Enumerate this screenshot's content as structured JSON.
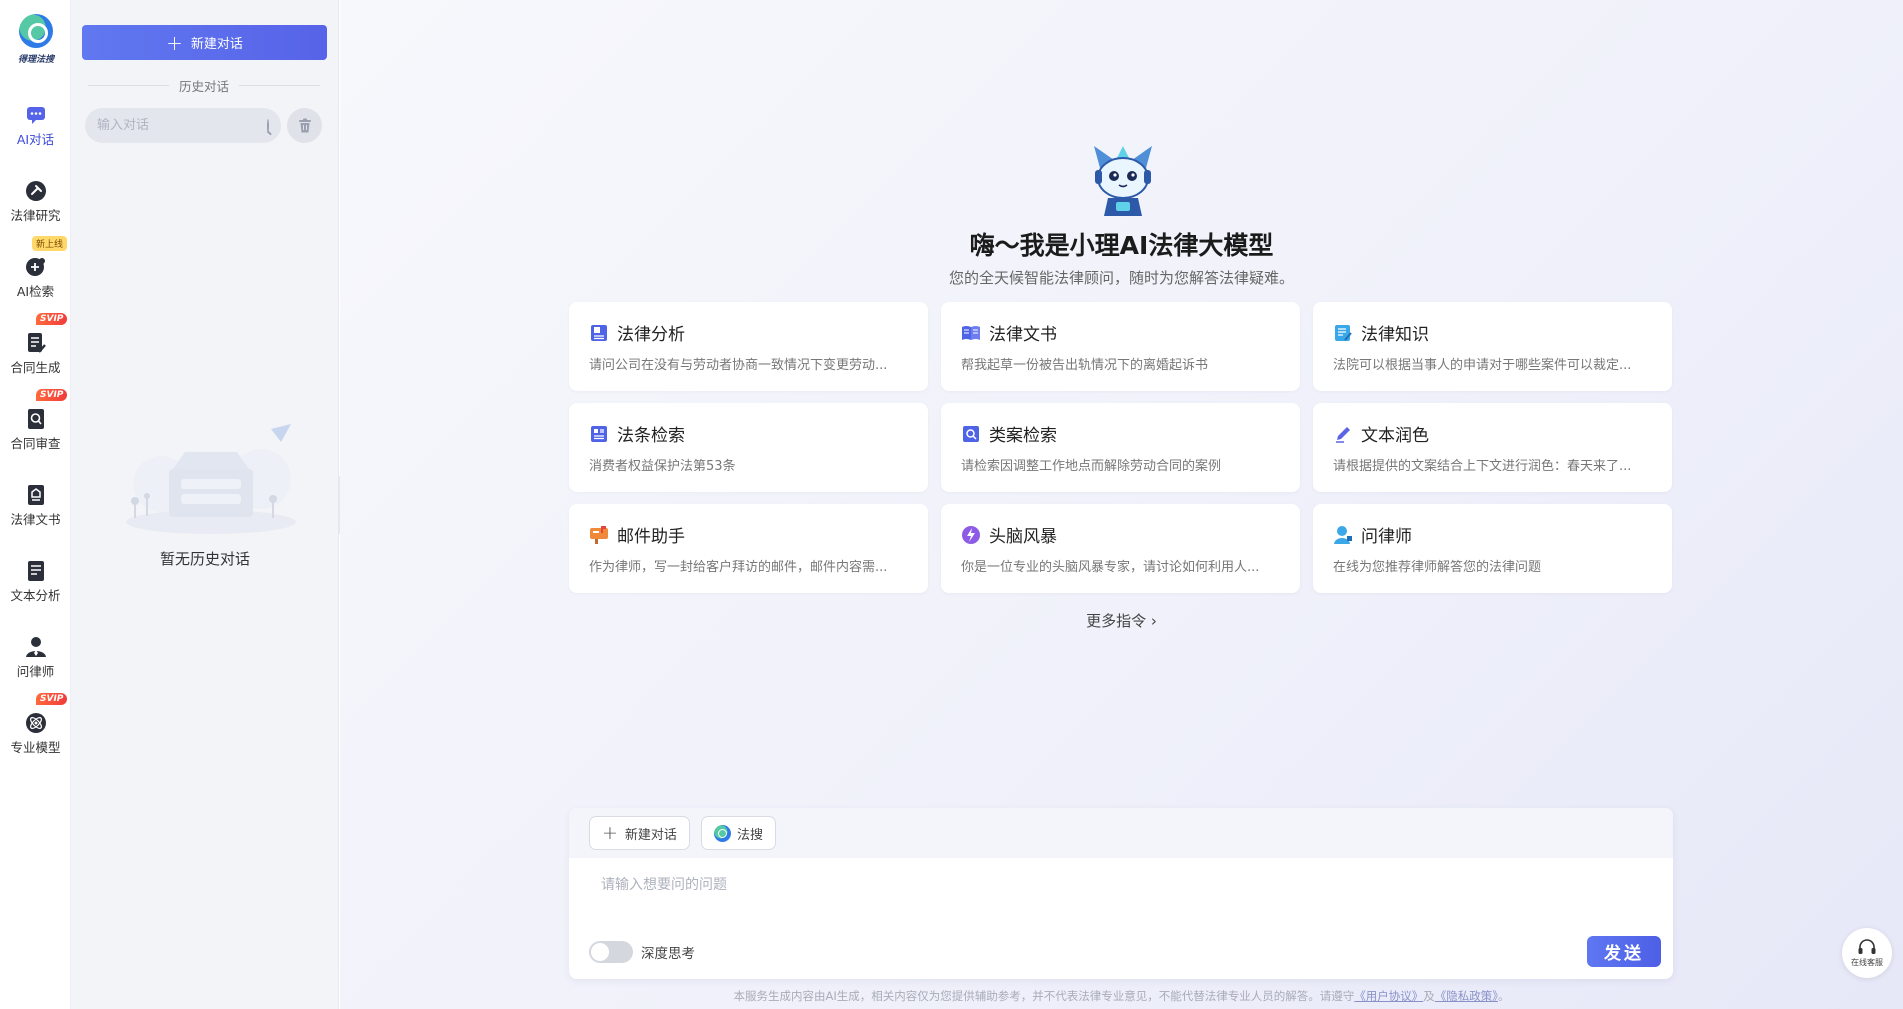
{
  "logo": {
    "text": "得理法搜"
  },
  "rail": {
    "items": [
      {
        "label": "AI对话",
        "icon": "chat-bubble-icon",
        "active": true
      },
      {
        "label": "法律研究",
        "icon": "magnifier-gavel-icon"
      },
      {
        "label": "AI检索",
        "icon": "ai-search-icon",
        "badge": "新上线"
      },
      {
        "label": "合同生成",
        "icon": "doc-pen-icon",
        "badge": "SVIP"
      },
      {
        "label": "合同审查",
        "icon": "doc-search-icon",
        "badge": "SVIP"
      },
      {
        "label": "法律文书",
        "icon": "doc-seal-icon"
      },
      {
        "label": "文本分析",
        "icon": "doc-lines-icon"
      },
      {
        "label": "问律师",
        "icon": "lawyer-icon"
      },
      {
        "label": "专业模型",
        "icon": "atom-icon",
        "badge": "SVIP"
      }
    ]
  },
  "history": {
    "new_chat_label": "新建对话",
    "section_title": "历史对话",
    "search_placeholder": "输入对话",
    "empty_text": "暂无历史对话"
  },
  "hero": {
    "title": "嗨～我是小理AI法律大模型",
    "subtitle": "您的全天候智能法律顾问，随时为您解答法律疑难。"
  },
  "cards": [
    {
      "title": "法律分析",
      "desc": "请问公司在没有与劳动者协商一致情况下变更劳动...",
      "icon": "book-icon",
      "color": "#4f63e6"
    },
    {
      "title": "法律文书",
      "desc": "帮我起草一份被告出轨情况下的离婚起诉书",
      "icon": "open-book-icon",
      "color": "#4f63e6"
    },
    {
      "title": "法律知识",
      "desc": "法院可以根据当事人的申请对于哪些案件可以裁定...",
      "icon": "knowledge-icon",
      "color": "#3aa7e8"
    },
    {
      "title": "法条检索",
      "desc": "消费者权益保护法第53条",
      "icon": "statute-icon",
      "color": "#4f63e6"
    },
    {
      "title": "类案检索",
      "desc": "请检索因调整工作地点而解除劳动合同的案例",
      "icon": "case-search-icon",
      "color": "#4f63e6"
    },
    {
      "title": "文本润色",
      "desc": "请根据提供的文案结合上下文进行润色：春天来了...",
      "icon": "pen-icon",
      "color": "#5b63e6"
    },
    {
      "title": "邮件助手",
      "desc": "作为律师，写一封给客户拜访的邮件，邮件内容需...",
      "icon": "mailbox-icon",
      "color": "#f08a3a"
    },
    {
      "title": "头脑风暴",
      "desc": "你是一位专业的头脑风暴专家，请讨论如何利用人...",
      "icon": "brain-icon",
      "color": "#8c5ce6"
    },
    {
      "title": "问律师",
      "desc": "在线为您推荐律师解答您的法律问题",
      "icon": "user-icon",
      "color": "#3aa7e8"
    }
  ],
  "more_commands": "更多指令",
  "composer": {
    "new_chat_chip": "新建对话",
    "fasou_chip": "法搜",
    "placeholder": "请输入想要问的问题",
    "deep_think_label": "深度思考",
    "send_label": "发送"
  },
  "disclaimer": {
    "text": "本服务生成内容由AI生成，相关内容仅为您提供辅助参考，并不代表法律专业意见，不能代替法律专业人员的解答。请遵守",
    "link1": "《用户协议》",
    "and": "及",
    "link2": "《隐私政策》",
    "tail": "。"
  },
  "customer_service": {
    "label": "在线客服"
  }
}
